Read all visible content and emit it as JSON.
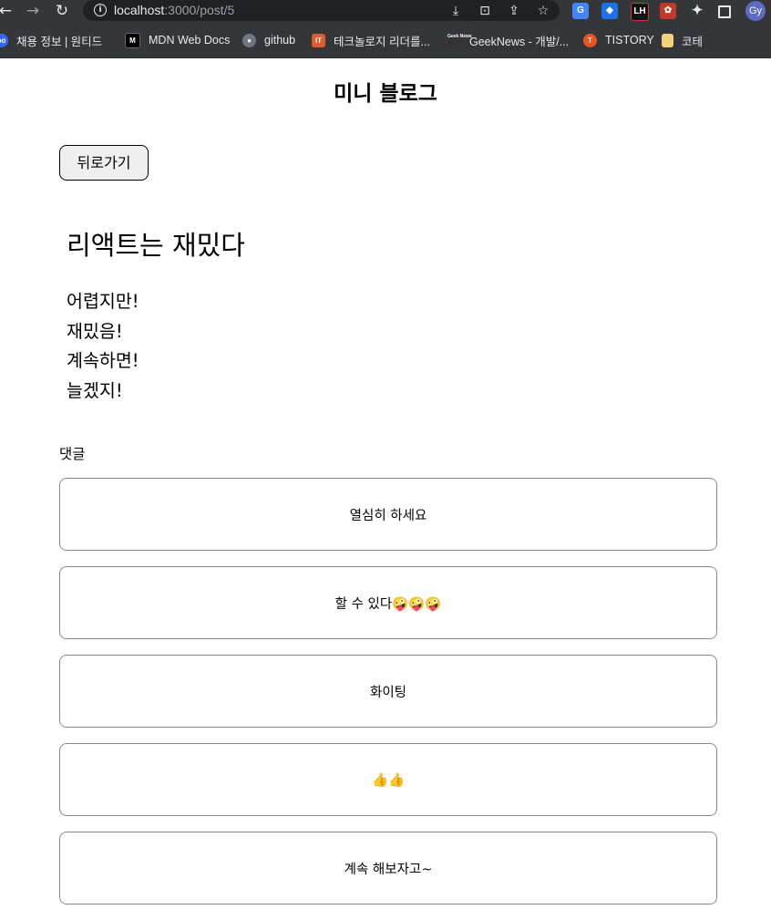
{
  "browser": {
    "url_host": "localhost",
    "url_path": ":3000/post/5",
    "avatar_initials": "Gy",
    "bookmarks": [
      {
        "label": "채용 정보 | 원티드",
        "icon": "wanted-icon",
        "color": "#3366ff"
      },
      {
        "label": "MDN Web Docs",
        "icon": "mdn-icon",
        "color": "#000000"
      },
      {
        "label": "github",
        "icon": "github-icon",
        "color": "#6e7681"
      },
      {
        "label": "테크놀로지 리더를...",
        "icon": "itworld-icon",
        "color": "#e05a2b"
      },
      {
        "label": "GeekNews - 개발/...",
        "icon": "geeknews-icon",
        "color": "#333333"
      },
      {
        "label": "TISTORY",
        "icon": "tistory-icon",
        "color": "#eb531f"
      },
      {
        "label": "코테",
        "icon": "folder-icon",
        "color": "#f2d37a"
      }
    ]
  },
  "page": {
    "site_title": "미니 블로그",
    "back_label": "뒤로가기",
    "post_title": "리액트는 재밌다",
    "post_lines": [
      "어렵지만!",
      "재밌음!",
      "계속하면!",
      "늘겠지!"
    ],
    "comments_label": "댓글",
    "comments": [
      "열심히 하세요",
      "할 수 있다🤪🤪🤪",
      "화이팅",
      "👍👍",
      "계속 해보자고~"
    ]
  }
}
